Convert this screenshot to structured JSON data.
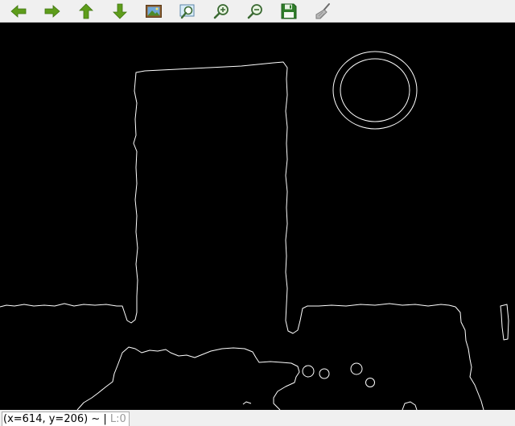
{
  "toolbar": {
    "buttons": [
      {
        "id": "back",
        "icon": "arrow-left-icon"
      },
      {
        "id": "forward",
        "icon": "arrow-right-icon"
      },
      {
        "id": "up",
        "icon": "arrow-up-icon"
      },
      {
        "id": "down",
        "icon": "arrow-down-icon"
      },
      {
        "id": "image",
        "icon": "picture-icon"
      },
      {
        "id": "zoom-fit",
        "icon": "zoom-region-icon"
      },
      {
        "id": "zoom-in",
        "icon": "zoom-in-icon"
      },
      {
        "id": "zoom-out",
        "icon": "zoom-out-icon"
      },
      {
        "id": "save",
        "icon": "floppy-save-icon"
      },
      {
        "id": "clear",
        "icon": "broom-icon"
      }
    ]
  },
  "status": {
    "coords": "(x=614, y=206) ~",
    "level": "L:0"
  },
  "colors": {
    "arrow": "#5e9d1b",
    "canvas": "#000000",
    "edges": "#ffffff"
  }
}
